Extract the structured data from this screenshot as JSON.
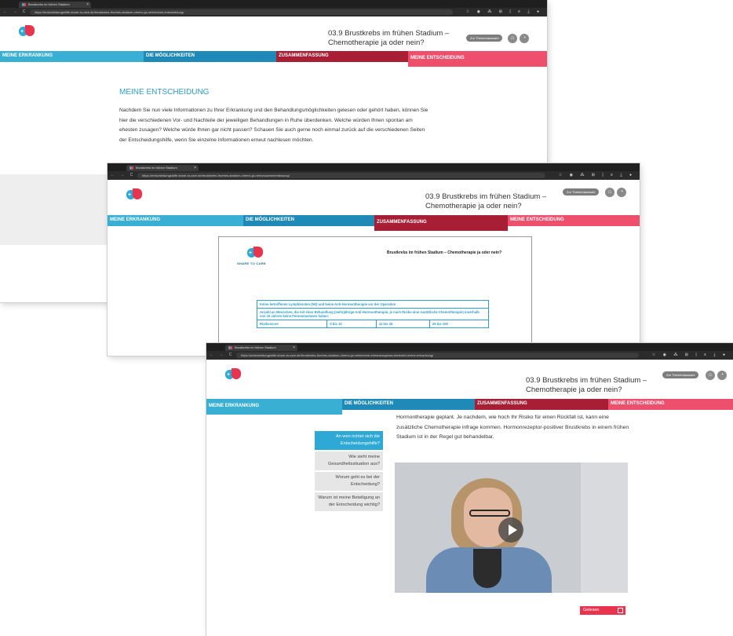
{
  "browser": {
    "tab_label": "Brustkrebs im frühen Stadium",
    "tab_close": "×",
    "nav_glyphs": "← → C",
    "toolbar_glyphs": "☆ ◉ ⁂ ⊞ | ≡ ⤓ ●",
    "url_1": "https://entscheidungshilfe.share-to-care.de/brustkrebs-fruehes-stadium-chemo-ja-nein/meine-entscheidung/",
    "url_2": "https://entscheidungshilfe.share-to-care.de/brustkrebs-fruehes-stadium-chemo-ja-nein/zusammenfassung/",
    "url_3": "https://entscheidungshilfe.share-to-care.de/brustkrebs-fruehes-stadium-chemo-ja-nein/meine-erkrankung/was-bedeutet-meine-erkrankung/"
  },
  "header": {
    "logo_plus": "+",
    "title_line1": "03.9 Brustkrebs im frühen Stadium –",
    "title_line2": "Chemotherapie ja oder nein?",
    "topic_button": "Zur Themenauswahl",
    "icon_home": "⌂",
    "icon_tool": "◔"
  },
  "nav": {
    "meine_erkrankung": "MEINE ERKRANKUNG",
    "moeglichkeiten": "DIE MÖGLICHKEITEN",
    "zusammenfassung": "ZUSAMMENFASSUNG",
    "meine_entscheidung": "MEINE ENTSCHEIDUNG"
  },
  "window1": {
    "heading": "MEINE ENTSCHEIDUNG",
    "paragraph": "Nachdem Sie nun viele Informationen zu Ihrer Erkrankung und den Behandlungsmöglichkeiten gelesen oder gehört haben, können Sie hier die verschiedenen Vor- und Nachteile der jeweiligen Behandlungen in Ruhe überdenken. Welche würden Ihnen spontan am ehesten zusagen? Welche würde Ihnen gar nicht passen? Schauen Sie auch gerne noch einmal zurück auf die verschiedenen Seiten der Entscheidungshilfe, wenn Sie einzelne Informationen erneut nachlesen möchten."
  },
  "window2": {
    "doc_title": "Brustkrebs im frühen Stadium – Chemotherapie ja oder nein?",
    "doc_logo_text": "SHARE TO CARE",
    "table_header": "Keine betroffenen Lymphknoten (N0) und keine Anti-Hormontherapie vor der Operation",
    "table_subheader": "Anzahl an Menschen, die mit einer Behandlung (mehrjährige Anti-Hormontherapie, je nach Risiko eine zusätzliche Chemotherapie) innerhalb von 10 Jahren keine Fernmetastasen haben:",
    "columns": [
      "Risikoscore",
      "0 bis 10",
      "11 bis 25",
      "26 bis 100"
    ]
  },
  "window3": {
    "sidebar": [
      "An wen richtet sich die Entscheidungshilfe?",
      "Wie sieht meine Gesundheitssituation aus?",
      "Worum geht es bei der Entscheidung?",
      "Warum ist meine Beteiligung an der Entscheidung wichtig?"
    ],
    "paragraph": "Hormontherapie geplant. Je nachdem, wie hoch Ihr Risiko für einen Rückfall ist, kann eine zusätzliche Chemotherapie infrage kommen. Hormonrezeptor-positiver Brustkrebs in einem frühen Stadium ist in der Regel gut behandelbar.",
    "read_button": "Gelesen"
  },
  "colors": {
    "nav_light_blue": "#38afd3",
    "nav_blue": "#1f8ab8",
    "nav_dark_red": "#a81e35",
    "nav_pink": "#ed4f6d",
    "heading_blue": "#2b9fcd"
  }
}
